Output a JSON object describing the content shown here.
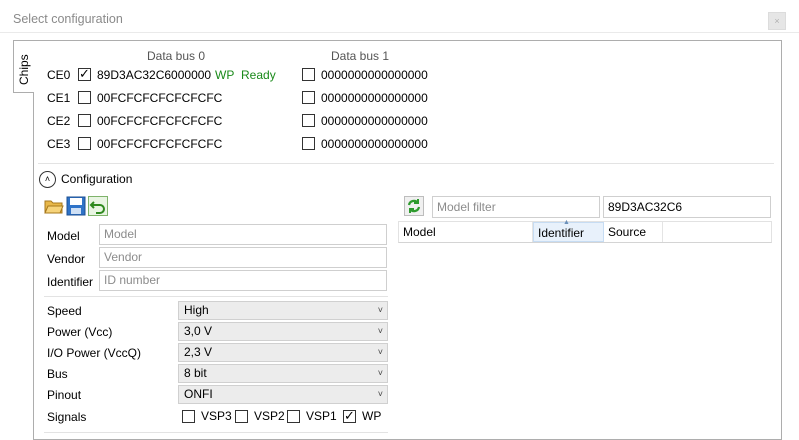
{
  "window": {
    "title": "Select configuration",
    "close_label": "×"
  },
  "tab": {
    "label": "Chips"
  },
  "bus_headers": [
    "Data bus 0",
    "Data bus 1"
  ],
  "chips": [
    {
      "ce": "CE0",
      "bus0_checked": true,
      "bus0_id": "89D3AC32C6000000",
      "bus0_wp": "WP",
      "bus0_status": "Ready",
      "bus1_checked": false,
      "bus1_id": "0000000000000000"
    },
    {
      "ce": "CE1",
      "bus0_checked": false,
      "bus0_id": "00FCFCFCFCFCFCFC",
      "bus1_checked": false,
      "bus1_id": "0000000000000000"
    },
    {
      "ce": "CE2",
      "bus0_checked": false,
      "bus0_id": "00FCFCFCFCFCFCFC",
      "bus1_checked": false,
      "bus1_id": "0000000000000000"
    },
    {
      "ce": "CE3",
      "bus0_checked": false,
      "bus0_id": "00FCFCFCFCFCFCFC",
      "bus1_checked": false,
      "bus1_id": "0000000000000000"
    }
  ],
  "configuration": {
    "label": "Configuration",
    "fields": {
      "model": {
        "label": "Model",
        "placeholder": "Model"
      },
      "vendor": {
        "label": "Vendor",
        "placeholder": "Vendor"
      },
      "identifier": {
        "label": "Identifier",
        "placeholder": "ID number"
      }
    },
    "settings": {
      "speed": {
        "label": "Speed",
        "value": "High"
      },
      "power": {
        "label": "Power (Vcc)",
        "value": "3,0 V"
      },
      "io_power": {
        "label": "I/O Power (VccQ)",
        "value": "2,3 V"
      },
      "bus": {
        "label": "Bus",
        "value": "8 bit"
      },
      "pinout": {
        "label": "Pinout",
        "value": "ONFI"
      }
    },
    "signals": {
      "label": "Signals",
      "items": [
        {
          "label": "VSP3",
          "checked": false
        },
        {
          "label": "VSP2",
          "checked": false
        },
        {
          "label": "VSP1",
          "checked": false
        },
        {
          "label": "WP",
          "checked": true
        }
      ]
    }
  },
  "models": {
    "filter_placeholder": "Model filter",
    "id_filter_value": "89D3AC32C6",
    "columns": [
      "Model",
      "Identifier",
      "Source"
    ]
  },
  "icons": {
    "open": "folder-open-icon",
    "save": "save-icon",
    "undo": "undo-icon",
    "refresh": "refresh-icon"
  },
  "colors": {
    "status_green": "#1a8a1a",
    "panel_border": "#adadad"
  }
}
